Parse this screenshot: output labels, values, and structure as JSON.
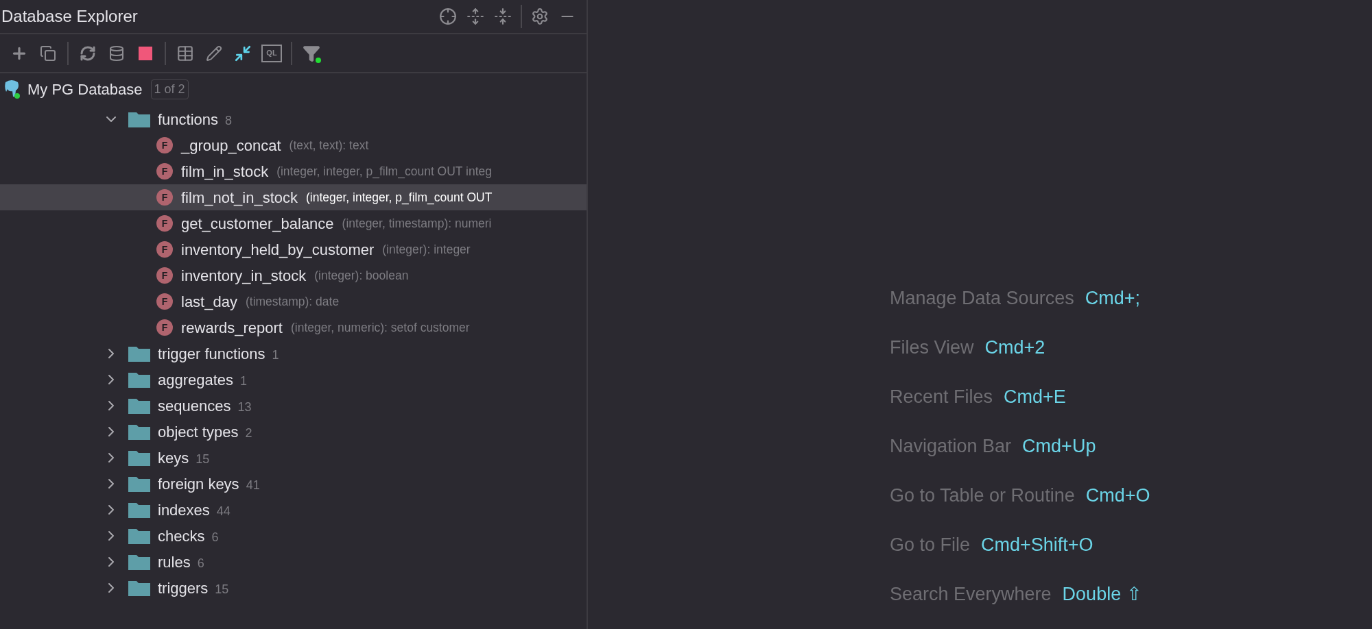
{
  "panel": {
    "title": "Database Explorer"
  },
  "toolbar": {
    "ql_label": "QL"
  },
  "tree": {
    "kind": "database",
    "label": "My PG Database",
    "badge": "1 of 2",
    "selected": false,
    "children": [
      {
        "kind": "folder",
        "label": "functions",
        "count": "8",
        "expanded": true,
        "selected": false,
        "children": [
          {
            "kind": "function",
            "letter": "F",
            "label": "_group_concat",
            "detail": "(text, text): text",
            "selected": false
          },
          {
            "kind": "function",
            "letter": "F",
            "label": "film_in_stock",
            "detail": "(integer, integer, p_film_count OUT integ",
            "selected": false
          },
          {
            "kind": "function",
            "letter": "F",
            "label": "film_not_in_stock",
            "detail": "(integer, integer, p_film_count OUT",
            "selected": true
          },
          {
            "kind": "function",
            "letter": "F",
            "label": "get_customer_balance",
            "detail": "(integer, timestamp): numeri",
            "selected": false
          },
          {
            "kind": "function",
            "letter": "F",
            "label": "inventory_held_by_customer",
            "detail": "(integer): integer",
            "selected": false
          },
          {
            "kind": "function",
            "letter": "F",
            "label": "inventory_in_stock",
            "detail": "(integer): boolean",
            "selected": false
          },
          {
            "kind": "function",
            "letter": "F",
            "label": "last_day",
            "detail": "(timestamp): date",
            "selected": false
          },
          {
            "kind": "function",
            "letter": "F",
            "label": "rewards_report",
            "detail": "(integer, numeric): setof customer",
            "selected": false
          }
        ]
      },
      {
        "kind": "folder",
        "label": "trigger functions",
        "count": "1",
        "expanded": false,
        "selected": false
      },
      {
        "kind": "folder",
        "label": "aggregates",
        "count": "1",
        "expanded": false,
        "selected": false
      },
      {
        "kind": "folder",
        "label": "sequences",
        "count": "13",
        "expanded": false,
        "selected": false
      },
      {
        "kind": "folder",
        "label": "object types",
        "count": "2",
        "expanded": false,
        "selected": false
      },
      {
        "kind": "folder",
        "label": "keys",
        "count": "15",
        "expanded": false,
        "selected": false
      },
      {
        "kind": "folder",
        "label": "foreign keys",
        "count": "41",
        "expanded": false,
        "selected": false
      },
      {
        "kind": "folder",
        "label": "indexes",
        "count": "44",
        "expanded": false,
        "selected": false
      },
      {
        "kind": "folder",
        "label": "checks",
        "count": "6",
        "expanded": false,
        "selected": false
      },
      {
        "kind": "folder",
        "label": "rules",
        "count": "6",
        "expanded": false,
        "selected": false
      },
      {
        "kind": "folder",
        "label": "triggers",
        "count": "15",
        "expanded": false,
        "selected": false
      }
    ]
  },
  "shortcuts": [
    {
      "label": "Manage Data Sources",
      "keys": "Cmd+;"
    },
    {
      "label": "Files View",
      "keys": "Cmd+2"
    },
    {
      "label": "Recent Files",
      "keys": "Cmd+E"
    },
    {
      "label": "Navigation Bar",
      "keys": "Cmd+Up"
    },
    {
      "label": "Go to Table or Routine",
      "keys": "Cmd+O"
    },
    {
      "label": "Go to File",
      "keys": "Cmd+Shift+O"
    },
    {
      "label": "Search Everywhere",
      "keys": "Double ⇧"
    }
  ]
}
